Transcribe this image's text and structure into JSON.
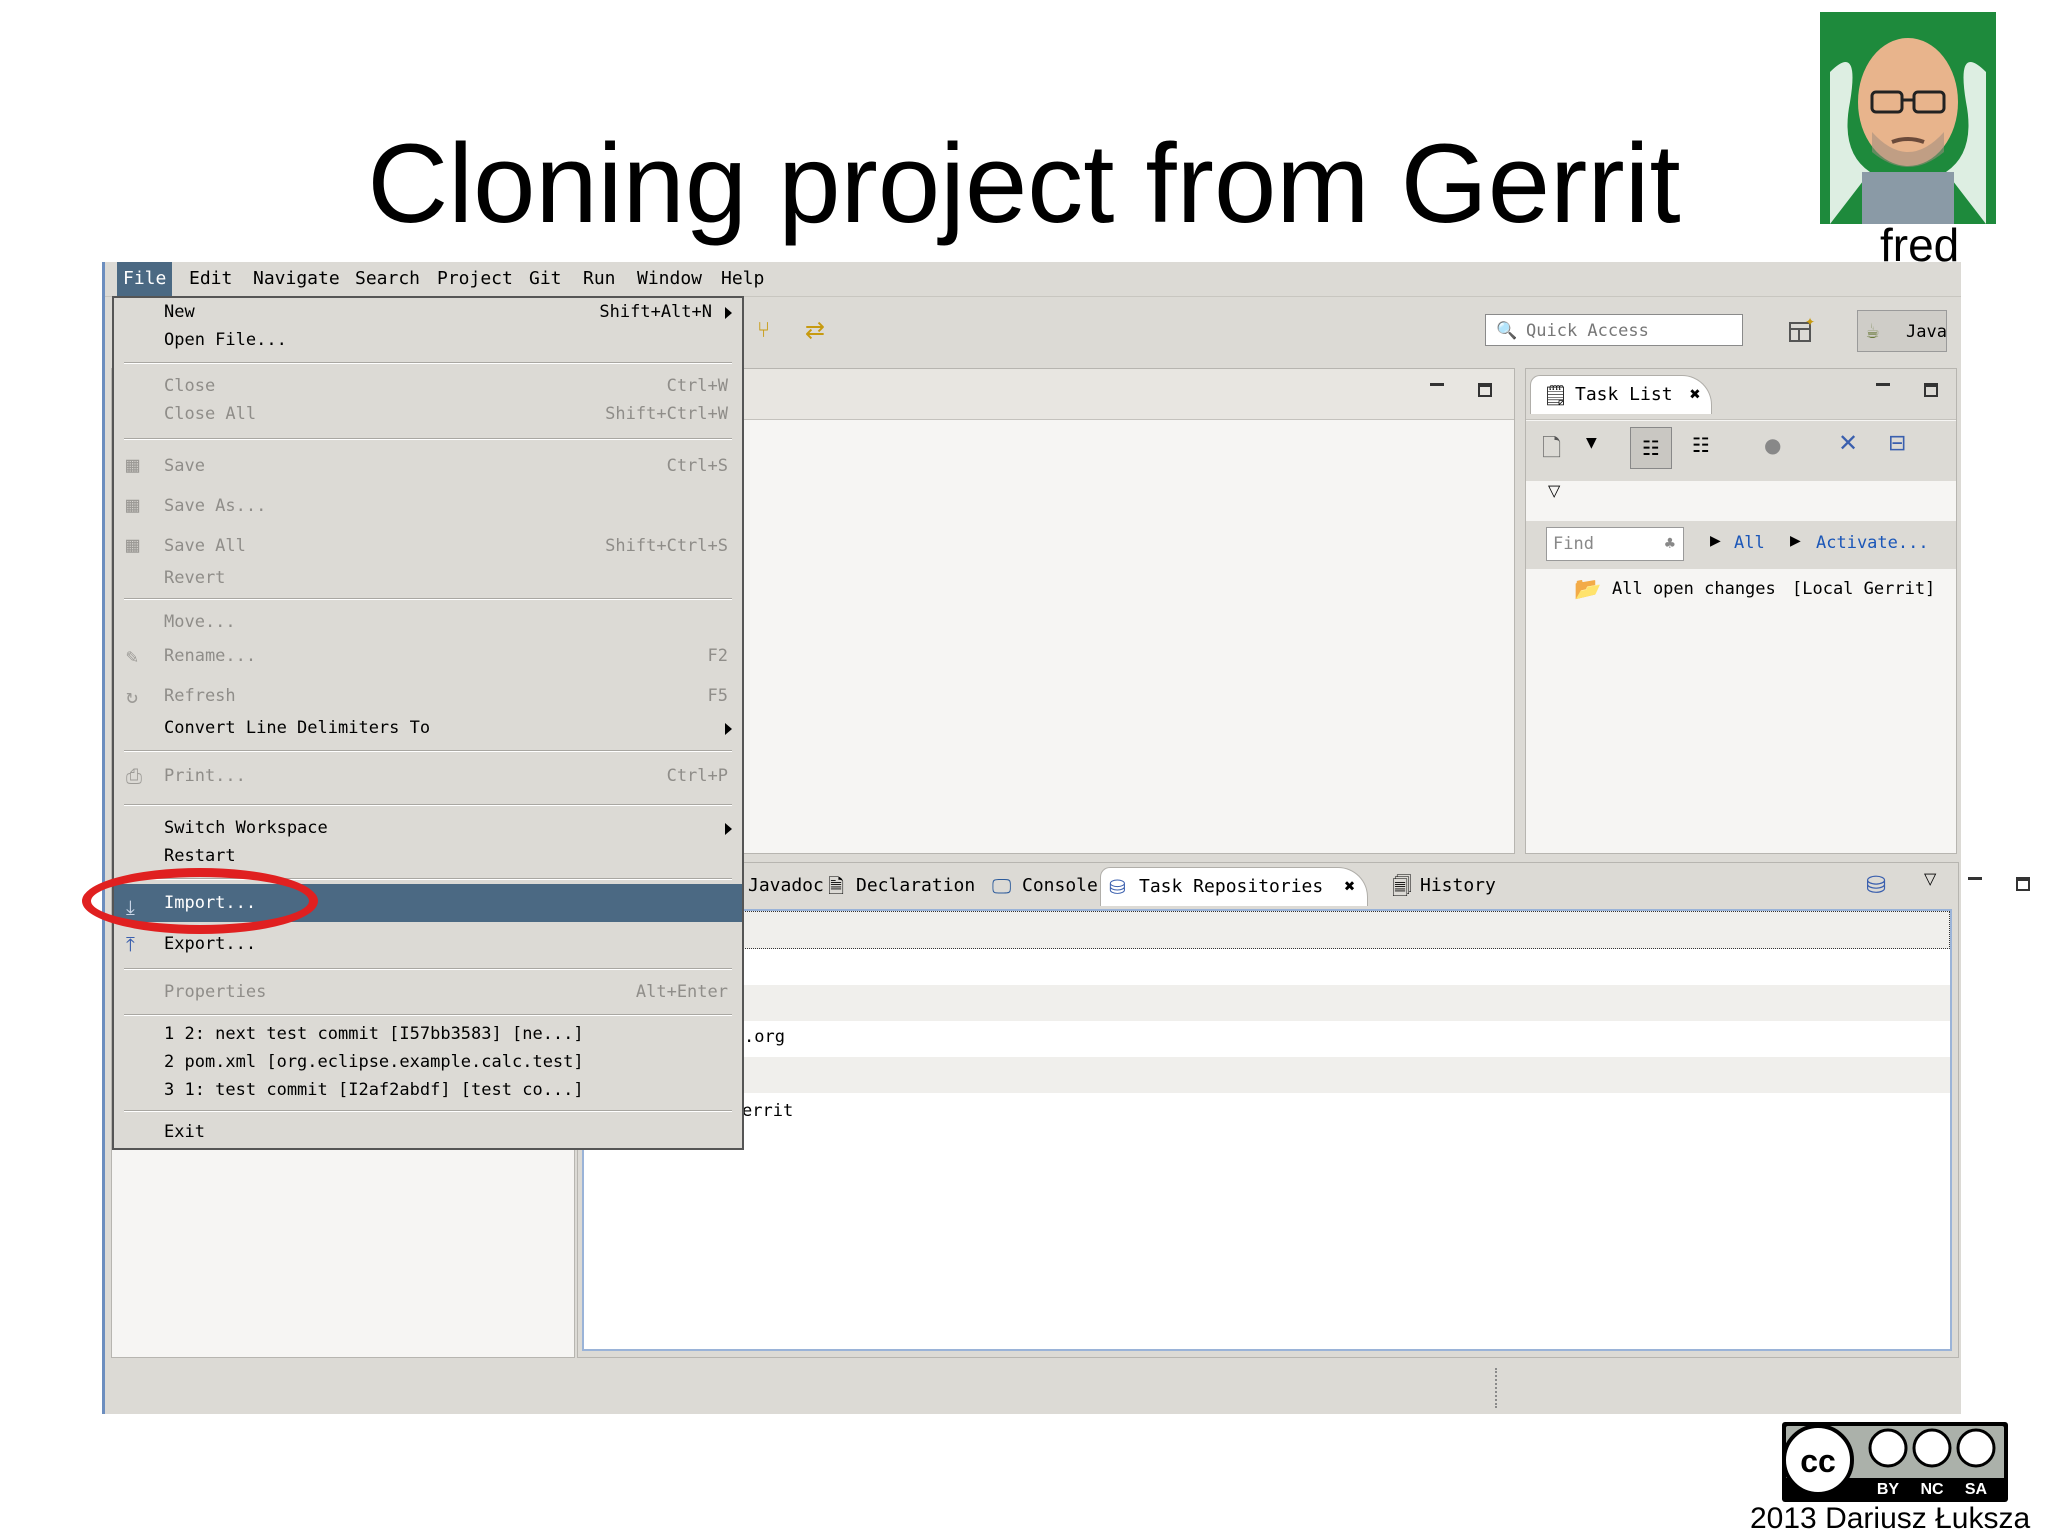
{
  "slide": {
    "title": "Cloning project from Gerrit",
    "avatar_label": "fred",
    "credit": "2013 Dariusz Łuksza",
    "license_badge": [
      "BY",
      "NC",
      "SA"
    ]
  },
  "menubar": {
    "items": [
      "File",
      "Edit",
      "Navigate",
      "Search",
      "Project",
      "Git",
      "Run",
      "Window",
      "Help"
    ],
    "active": "File"
  },
  "toolbar": {
    "quick_access_placeholder": "Quick Access",
    "perspective_label": "Java"
  },
  "task_list": {
    "tab_label": "Task List",
    "find_placeholder": "Find",
    "filter_all": "All",
    "activate_link": "Activate...",
    "query_label": "All open changes",
    "query_repo": "[Local Gerrit]"
  },
  "bottom_tabs": [
    "Javadoc",
    "Declaration",
    "Console",
    "Task Repositories",
    "History"
  ],
  "repositories_visible_text": [
    ".org",
    "errit"
  ],
  "file_menu": {
    "items": [
      {
        "label": "New",
        "accel": "Shift+Alt+N",
        "submenu": true,
        "enabled": true
      },
      {
        "label": "Open File...",
        "accel": "",
        "enabled": true
      },
      {
        "label": "Close",
        "accel": "Ctrl+W",
        "enabled": false
      },
      {
        "label": "Close All",
        "accel": "Shift+Ctrl+W",
        "enabled": false
      },
      {
        "label": "Save",
        "accel": "Ctrl+S",
        "enabled": false
      },
      {
        "label": "Save As...",
        "accel": "",
        "enabled": false
      },
      {
        "label": "Save All",
        "accel": "Shift+Ctrl+S",
        "enabled": false
      },
      {
        "label": "Revert",
        "accel": "",
        "enabled": false
      },
      {
        "label": "Move...",
        "accel": "",
        "enabled": false
      },
      {
        "label": "Rename...",
        "accel": "F2",
        "enabled": false
      },
      {
        "label": "Refresh",
        "accel": "F5",
        "enabled": false
      },
      {
        "label": "Convert Line Delimiters To",
        "accel": "",
        "submenu": true,
        "enabled": true
      },
      {
        "label": "Print...",
        "accel": "Ctrl+P",
        "enabled": false
      },
      {
        "label": "Switch Workspace",
        "accel": "",
        "submenu": true,
        "enabled": true
      },
      {
        "label": "Restart",
        "accel": "",
        "enabled": true
      },
      {
        "label": "Import...",
        "accel": "",
        "enabled": true,
        "selected": true
      },
      {
        "label": "Export...",
        "accel": "",
        "enabled": true
      },
      {
        "label": "Properties",
        "accel": "Alt+Enter",
        "enabled": false
      },
      {
        "label": "1 2: next test commit [I57bb3583]  [ne...]",
        "enabled": true
      },
      {
        "label": "2 pom.xml  [org.eclipse.example.calc.test]",
        "enabled": true
      },
      {
        "label": "3 1: test commit [I2af2abdf]  [test co...]",
        "enabled": true
      },
      {
        "label": "Exit",
        "enabled": true
      }
    ]
  },
  "colors": {
    "selection": "#4b6983",
    "highlight_ellipse": "#e02020",
    "link": "#1a56b8"
  }
}
